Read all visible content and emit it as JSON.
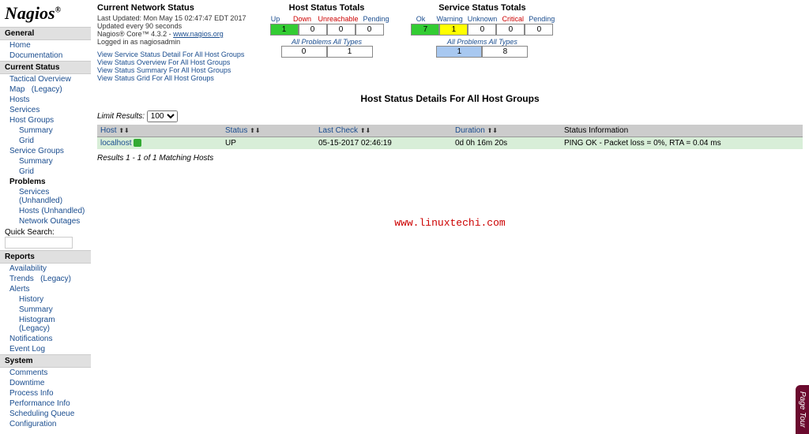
{
  "logo": "Nagios",
  "nav": {
    "general": {
      "header": "General",
      "items": [
        "Home",
        "Documentation"
      ]
    },
    "current_status": {
      "header": "Current Status",
      "tactical": "Tactical Overview",
      "map": "Map",
      "map_legacy": "(Legacy)",
      "hosts": "Hosts",
      "services": "Services",
      "host_groups": "Host Groups",
      "hg_summary": "Summary",
      "hg_grid": "Grid",
      "service_groups": "Service Groups",
      "sg_summary": "Summary",
      "sg_grid": "Grid",
      "problems": "Problems",
      "p_services": "Services (Unhandled)",
      "p_hosts": "Hosts (Unhandled)",
      "p_outages": "Network Outages",
      "quick_search": "Quick Search:"
    },
    "reports": {
      "header": "Reports",
      "availability": "Availability",
      "trends": "Trends",
      "trends_legacy": "(Legacy)",
      "alerts": "Alerts",
      "a_history": "History",
      "a_summary": "Summary",
      "a_histogram": "Histogram (Legacy)",
      "notifications": "Notifications",
      "event_log": "Event Log"
    },
    "system": {
      "header": "System",
      "items": [
        "Comments",
        "Downtime",
        "Process Info",
        "Performance Info",
        "Scheduling Queue",
        "Configuration"
      ]
    }
  },
  "status": {
    "title": "Current Network Status",
    "last_updated": "Last Updated: Mon May 15 02:47:47 EDT 2017",
    "updated_every": "Updated every 90 seconds",
    "version_pre": "Nagios® Core™ 4.3.2 - ",
    "version_link": "www.nagios.org",
    "logged_in": "Logged in as nagiosadmin",
    "links": [
      "View Service Status Detail For All Host Groups",
      "View Status Overview For All Host Groups",
      "View Status Summary For All Host Groups",
      "View Status Grid For All Host Groups"
    ]
  },
  "host_totals": {
    "title": "Host Status Totals",
    "headers": [
      "Up",
      "Down",
      "Unreachable",
      "Pending"
    ],
    "values": [
      "1",
      "0",
      "0",
      "0"
    ],
    "sub_label": "All Problems  All Types",
    "sub_values": [
      "0",
      "1"
    ]
  },
  "service_totals": {
    "title": "Service Status Totals",
    "headers": [
      "Ok",
      "Warning",
      "Unknown",
      "Critical",
      "Pending"
    ],
    "values": [
      "7",
      "1",
      "0",
      "0",
      "0"
    ],
    "sub_label": "All Problems  All Types",
    "sub_values": [
      "1",
      "8"
    ]
  },
  "details_title": "Host Status Details For All Host Groups",
  "limit_label": "Limit Results:",
  "limit_value": "100",
  "columns": {
    "host": "Host",
    "status": "Status",
    "last_check": "Last Check",
    "duration": "Duration",
    "info": "Status Information"
  },
  "row": {
    "host": "localhost",
    "status": "UP",
    "last_check": "05-15-2017 02:46:19",
    "duration": "0d 0h 16m 20s",
    "info": "PING OK - Packet loss = 0%, RTA = 0.04 ms"
  },
  "results_info": "Results 1 - 1 of 1 Matching Hosts",
  "watermark": "www.linuxtechi.com",
  "page_tour": "Page Tour"
}
